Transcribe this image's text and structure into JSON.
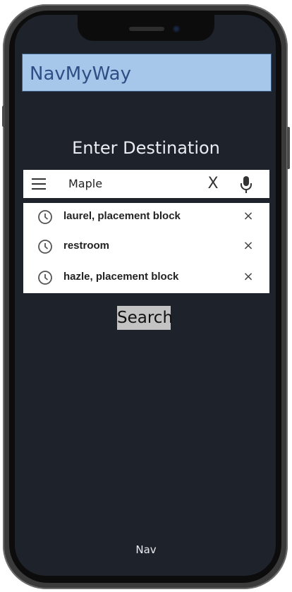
{
  "app": {
    "title": "NavMyWay"
  },
  "main": {
    "heading": "Enter Destination"
  },
  "search": {
    "menu_icon": "hamburger-menu-icon",
    "value": "Maple",
    "clear_label": "X",
    "mic_icon": "microphone-icon"
  },
  "suggestions": [
    {
      "label": "laurel, placement block",
      "icon": "history-clock-icon",
      "remove": "×"
    },
    {
      "label": "restroom",
      "icon": "history-clock-icon",
      "remove": "×"
    },
    {
      "label": "hazle, placement block",
      "icon": "history-clock-icon",
      "remove": "×"
    }
  ],
  "actions": {
    "search_label": "Search"
  },
  "nav": {
    "label": "Nav"
  },
  "colors": {
    "screen_bg": "#1e222b",
    "header_bg": "#a7c7ea",
    "header_text": "#2e4f85",
    "button_bg": "#c3c3c3"
  }
}
